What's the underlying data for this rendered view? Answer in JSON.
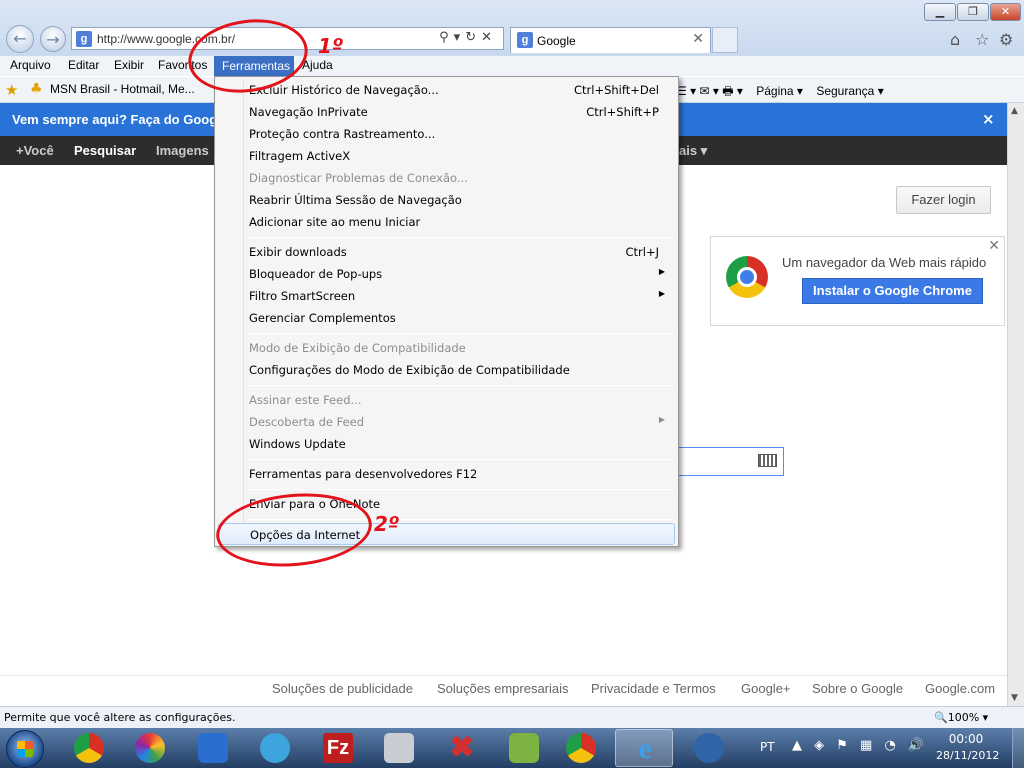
{
  "browser": {
    "address_url": "http://www.google.com.br/",
    "tab_label": "Google",
    "favicon_letter": "g",
    "window_controls": {
      "minimize": "▁",
      "maximize": "❐",
      "close": "✕"
    }
  },
  "menubar": {
    "items": [
      "Arquivo",
      "Editar",
      "Exibir",
      "Favoritos",
      "Ferramentas",
      "Ajuda"
    ],
    "active": "Ferramentas"
  },
  "favorites_bar": {
    "msn_label": "MSN Brasil - Hotmail, Me...",
    "page_menu": "Página ▾",
    "security_menu": "Segurança ▾"
  },
  "google": {
    "banner_text": "Vem sempre aqui? Faça do Goog",
    "banner_close": "×",
    "bar_items": [
      "+Você",
      "Pesquisar",
      "Imagens"
    ],
    "bar_more": "ais ▾",
    "login_button": "Fazer login",
    "promo_headline": "Um navegador da Web mais rápido",
    "promo_button": "Instalar o Google Chrome",
    "promo_close": "✕",
    "footer_links": [
      "Soluções de publicidade",
      "Soluções empresariais",
      "Privacidade e Termos",
      "Google+",
      "Sobre o Google",
      "Google.com"
    ]
  },
  "tools_menu": {
    "items": [
      {
        "label": "Excluir Histórico de Navegação...",
        "shortcut": "Ctrl+Shift+Del"
      },
      {
        "label": "Navegação InPrivate",
        "shortcut": "Ctrl+Shift+P"
      },
      {
        "label": "Proteção contra Rastreamento..."
      },
      {
        "label": "Filtragem ActiveX"
      },
      {
        "label": "Diagnosticar Problemas de Conexão...",
        "disabled": true
      },
      {
        "label": "Reabrir Última Sessão de Navegação"
      },
      {
        "label": "Adicionar site ao menu Iniciar"
      },
      {
        "label": "Exibir downloads",
        "shortcut": "Ctrl+J"
      },
      {
        "label": "Bloqueador de Pop-ups",
        "submenu": true
      },
      {
        "label": "Filtro SmartScreen",
        "submenu": true
      },
      {
        "label": "Gerenciar Complementos"
      },
      {
        "label": "Modo de Exibição de Compatibilidade",
        "disabled": true
      },
      {
        "label": "Configurações do Modo de Exibição de Compatibilidade"
      },
      {
        "label": "Assinar este Feed...",
        "disabled": true
      },
      {
        "label": "Descoberta de Feed",
        "disabled": true,
        "submenu": true
      },
      {
        "label": "Windows Update"
      },
      {
        "label": "Ferramentas para desenvolvedores F12"
      },
      {
        "label": "Enviar para o OneNote"
      },
      {
        "label": "Opções da Internet",
        "highlighted": true
      }
    ],
    "submenu_arrow": "▶"
  },
  "annotations": {
    "step1": "1º",
    "step2": "2º",
    "color": "#e3131b"
  },
  "statusbar": {
    "text": "Permite que você altere as configurações.",
    "zoom": "🔍100%  ▾"
  },
  "taskbar": {
    "language": "PT",
    "tray_icons": "▲ ◈ ⚑ ▦ ◔ 🔊",
    "time": "00:00",
    "date": "28/11/2012",
    "filezilla_glyph": "Fz",
    "ie_glyph": "e",
    "x_glyph": "✖"
  },
  "icons": {
    "back": "←",
    "forward": "→",
    "address_tools": "⚲▾↻✕",
    "home": "⌂",
    "star": "☆",
    "gear": "⚙",
    "favorites_star": "★",
    "msn": "♣",
    "feeds": "☰ ▾ ✉ ▾ 🖶 ▾"
  }
}
